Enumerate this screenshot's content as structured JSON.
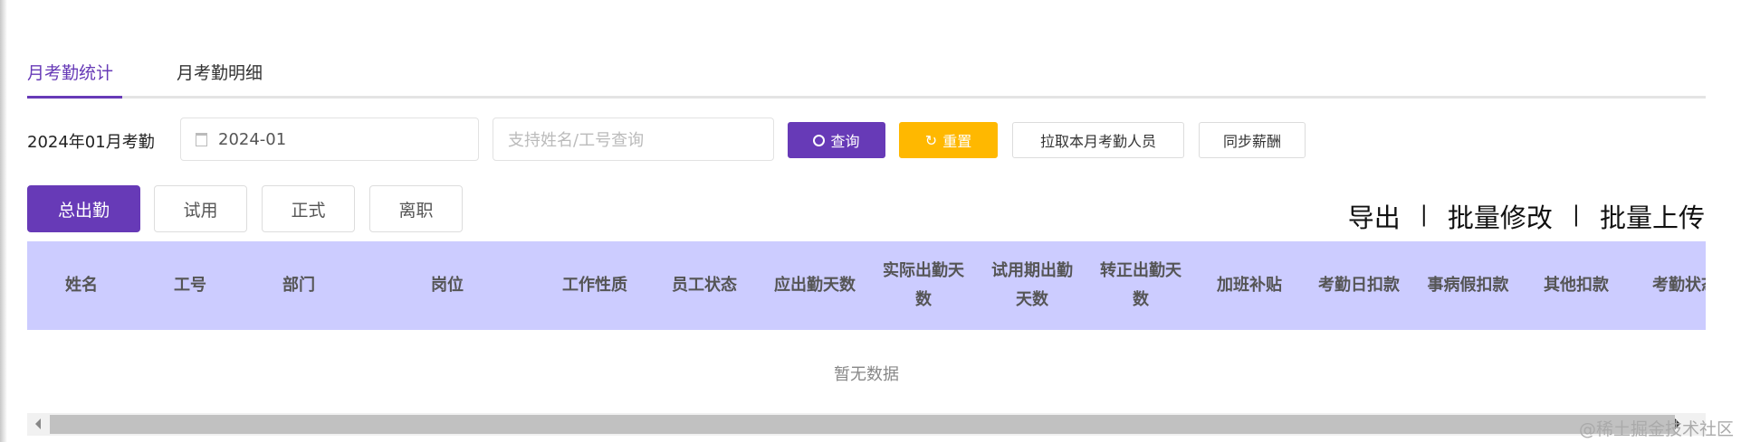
{
  "tabs": [
    {
      "label": "月考勤统计",
      "active": true
    },
    {
      "label": "月考勤明细",
      "active": false
    }
  ],
  "filter": {
    "label": "2024年01月考勤",
    "month_value": "2024-01",
    "search_placeholder": "支持姓名/工号查询",
    "query_label": "查询",
    "reset_label": "重置",
    "pull_label": "拉取本月考勤人员",
    "sync_label": "同步薪酬"
  },
  "status_buttons": [
    {
      "label": "总出勤",
      "active": true
    },
    {
      "label": "试用"
    },
    {
      "label": "正式"
    },
    {
      "label": "离职"
    }
  ],
  "actions": {
    "export": "导出",
    "batch_edit": "批量修改",
    "batch_upload": "批量上传",
    "separator": "|"
  },
  "table": {
    "columns": [
      "姓名",
      "工号",
      "部门",
      "岗位",
      "工作性质",
      "员工状态",
      "应出勤天数",
      "实际出勤天数",
      "试用期出勤天数",
      "转正出勤天数",
      "加班补贴",
      "考勤日扣款",
      "事病假扣款",
      "其他扣款",
      "考勤状态"
    ],
    "empty_text": "暂无数据"
  },
  "watermark": "@稀土掘金技术社区",
  "colors": {
    "primary": "#673ab7",
    "warning": "#ffb800",
    "header_bg": "#ccccff"
  }
}
